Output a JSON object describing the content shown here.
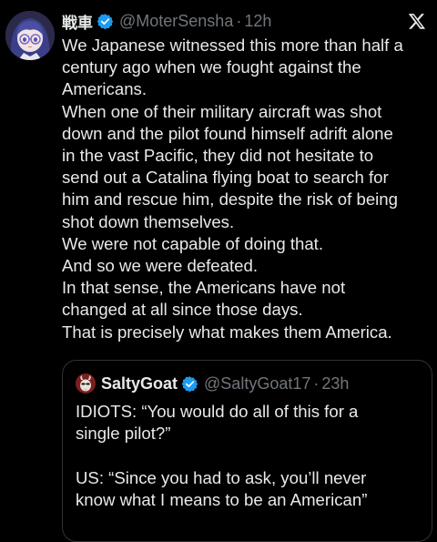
{
  "post": {
    "author": {
      "display_name": "戦車",
      "handle": "@MoterSensha",
      "separator": "·",
      "time": "12h",
      "verified": true,
      "avatar_icon": "anime-avatar-icon"
    },
    "platform_icon": "x-logo-icon",
    "text_lines": [
      "We Japanese witnessed this more than half a",
      "century ago when we fought against the",
      "Americans.",
      "When one of their military aircraft was shot",
      "down and the pilot found himself adrift alone",
      "in the vast Pacific, they did not hesitate to",
      "send out a Catalina flying boat to search for",
      "him and rescue him, despite the risk of being",
      "shot down themselves.",
      "We were not capable of doing that.",
      "And so we were defeated.",
      "In that sense, the Americans have not",
      "changed at all since those days.",
      "That is precisely what makes them America."
    ]
  },
  "quote": {
    "author": {
      "display_name": "SaltyGoat",
      "handle": "@SaltyGoat17",
      "separator": "·",
      "time": "23h",
      "verified": true,
      "avatar_icon": "goat-avatar-icon"
    },
    "text_lines": [
      "IDIOTS: “You would do all of this for a",
      "single pilot?”",
      "",
      "US: “Since you had to ask, you’ll never",
      "know what I means to be an American”"
    ]
  },
  "colors": {
    "background": "#000000",
    "text_primary": "#e7e9ea",
    "text_secondary": "#71767b",
    "verified_blue": "#1d9bf0",
    "border": "#2f3336"
  }
}
